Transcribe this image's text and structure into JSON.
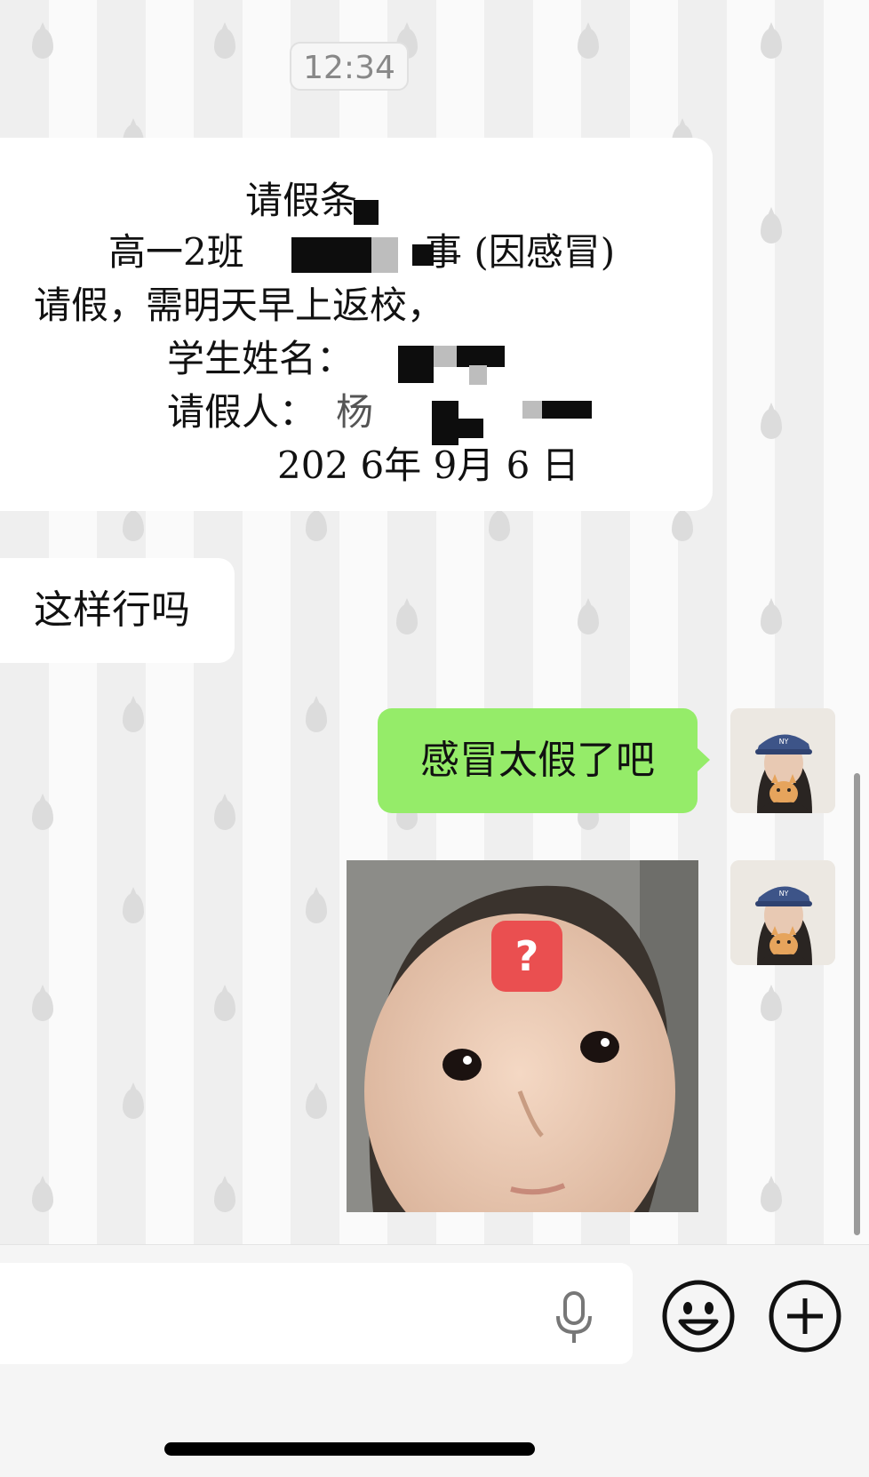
{
  "chat": {
    "timestamp": "12:34",
    "leave_note": {
      "title": "请假条",
      "line1_prefix": "高一2班",
      "line1_suffix": "事 (因感冒)",
      "line2": "请假，需明天早上返校，",
      "line3_label": "学生姓名：",
      "line4_label": "请假人：",
      "line4_partial": "杨",
      "date_text": "202 6年  9月 6 日"
    },
    "incoming_message": "这样行吗",
    "outgoing_message": "感冒太假了吧",
    "sticker_badge": "?"
  },
  "input_bar": {
    "text_value": "",
    "voice_icon": "microphone-icon",
    "emoji_icon": "smiley-icon",
    "more_icon": "plus-circle-icon"
  },
  "colors": {
    "outgoing_bubble": "#95ec69",
    "incoming_bubble": "#ffffff",
    "badge_red": "#ea4f50"
  }
}
